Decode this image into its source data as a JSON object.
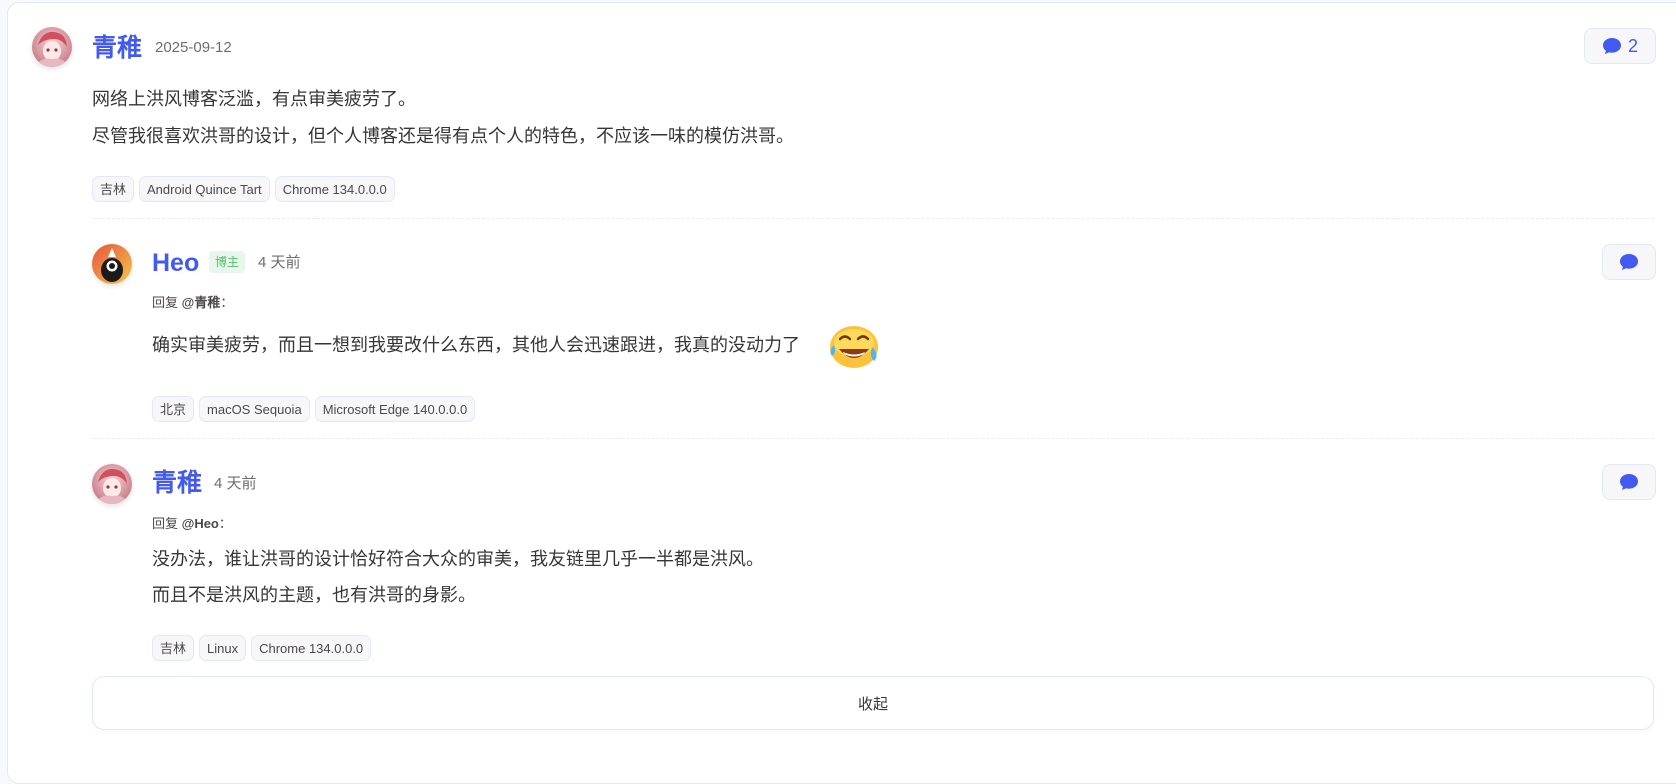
{
  "comment": {
    "author": "青稚",
    "date": "2025-09-12",
    "reply_count": "2",
    "lines": [
      "网络上洪风博客泛滥，有点审美疲劳了。",
      "尽管我很喜欢洪哥的设计，但个人博客还是得有点个人的特色，不应该一味的模仿洪哥。"
    ],
    "tags": [
      "吉林",
      "Android Quince Tart",
      "Chrome 134.0.0.0"
    ]
  },
  "replies": [
    {
      "author": "Heo",
      "badge": "博主",
      "date": "4 天前",
      "reply_prefix": "回复",
      "reply_target": "@青稚",
      "reply_suffix": "：",
      "lines": [
        "确实审美疲劳，而且一想到我要改什么东西，其他人会迅速跟进，我真的没动力了"
      ],
      "emoji": "crying-laughing-emoji",
      "tags": [
        "北京",
        "macOS Sequoia",
        "Microsoft Edge 140.0.0.0"
      ]
    },
    {
      "author": "青稚",
      "date": "4 天前",
      "reply_prefix": "回复",
      "reply_target": "@Heo",
      "reply_suffix": "：",
      "lines": [
        "没办法，谁让洪哥的设计恰好符合大众的审美，我友链里几乎一半都是洪风。",
        "而且不是洪风的主题，也有洪哥的身影。"
      ],
      "tags": [
        "吉林",
        "Linux",
        "Chrome 134.0.0.0"
      ]
    }
  ],
  "collapse_label": "收起",
  "colors": {
    "accent": "#425aef",
    "badge_text": "#57bd6a",
    "badge_bg": "#e8f7ec"
  },
  "icons": {
    "reply": "chat-bubble-icon"
  }
}
